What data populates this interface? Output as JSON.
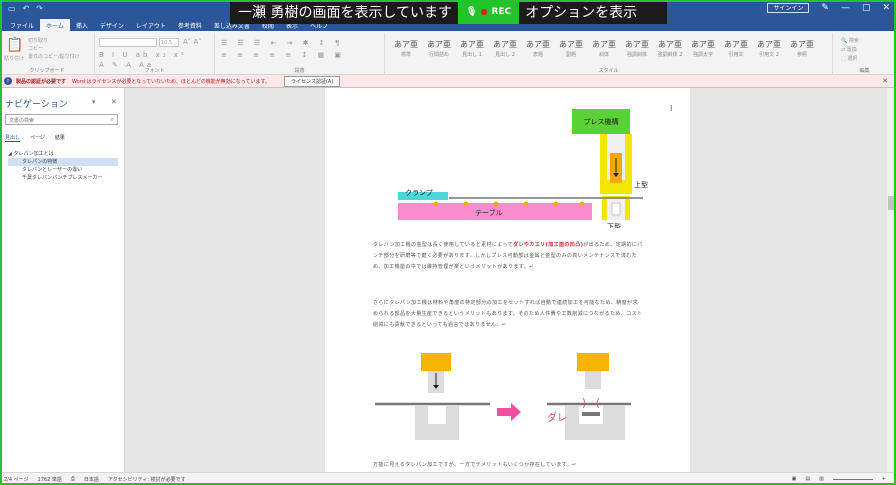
{
  "screen_share": {
    "presenter": "一瀬 勇樹の画面を表示しています",
    "rec_label": "REC",
    "options_label": "オプションを表示"
  },
  "title_bar": {
    "signin": "サインイン",
    "undo": "↶",
    "redo": "↷",
    "save": "▭"
  },
  "ribbon_tabs": [
    "ファイル",
    "ホーム",
    "挿入",
    "デザイン",
    "レイアウト",
    "参考資料",
    "差し込み文書",
    "校閲",
    "表示",
    "ヘルプ"
  ],
  "ribbon": {
    "clipboard": {
      "label": "クリップボード",
      "paste": "貼り付け",
      "cut": "切り取り",
      "copy": "コピー",
      "format_painter": "書式のコピー/貼り付け"
    },
    "font": {
      "label": "フォント",
      "font_size": "10.5"
    },
    "paragraph": {
      "label": "段落"
    },
    "styles": {
      "label": "スタイル",
      "items": [
        {
          "sample": "あア亜",
          "name": "標準"
        },
        {
          "sample": "あア亜",
          "name": "行間詰め"
        },
        {
          "sample": "あア亜",
          "name": "見出し 1"
        },
        {
          "sample": "あア亜",
          "name": "見出し 2"
        },
        {
          "sample": "あア亜",
          "name": "表題"
        },
        {
          "sample": "あア亜",
          "name": "副題"
        },
        {
          "sample": "あア亜",
          "name": "斜体"
        },
        {
          "sample": "あア亜",
          "name": "強調斜体"
        },
        {
          "sample": "あア亜",
          "name": "強調斜体 2"
        },
        {
          "sample": "あア亜",
          "name": "強調太字"
        },
        {
          "sample": "あア亜",
          "name": "引用文"
        },
        {
          "sample": "あア亜",
          "name": "引用文 2"
        },
        {
          "sample": "あア亜",
          "name": "参照"
        }
      ]
    },
    "editing": {
      "label": "編集",
      "find": "検索",
      "replace": "置換",
      "select": "選択"
    }
  },
  "banner": {
    "title": "製品の認証が必要です",
    "message": "Word はライセンスが必要となっていないため、ほとんどの機能が無効になっています。",
    "button": "ライセンス認証(A)"
  },
  "nav_pane": {
    "title": "ナビゲーション",
    "search_placeholder": "文書の検索",
    "tabs": [
      "見出し",
      "ページ",
      "結果"
    ],
    "tree": [
      "タレパン加工とは",
      "タレパンの特徴",
      "タレパンとレーザーの違い",
      "千葉タレパンパンチプレスメーカー"
    ]
  },
  "document": {
    "labels": {
      "press": "プレス機構",
      "clamp": "クランプ",
      "table": "テーブル",
      "upper": "上型",
      "lower": "下型",
      "dare": "ダレ"
    },
    "para1_before": "タレパン加工機の金型は長く使用していると素材によって",
    "para1_red": "ダレやカエリ(加工面の凹凸)",
    "para1_after": "が出るため、定期的にパンチ部分を研磨等で磨く必要があります。しかしプレス可動部は金属と金型のみの高いメンテナンスで済むため、加工機能の中では維持管理が楽というメリットがあります。↵",
    "para2": "さらにタレパン加工機は材料や角度の特定部分の加工をセットすれば自動で連続加工を可能なため、精度が求められる部品を大量生産できるというメリットもあります。そのため人件費や工数削減につながるため、コスト削減にも貢献できるといっても過言ではありません。↵",
    "para3": "万能に見えるタレパン加工ですが、一方でデメリットもいくつか存在しています。↵"
  },
  "status_bar": {
    "page": "2/4 ページ",
    "words": "1762 単語",
    "lang": "日本語",
    "accessibility": "アクセシビリティ: 検討が必要です",
    "zoom": "+"
  },
  "colors": {
    "word_blue": "#2b579a",
    "share_green": "#22c42a",
    "press_green": "#5cd136",
    "yellow": "#f3d100",
    "orange": "#f6a800",
    "pink": "#f98ccf",
    "cyan": "#4fd6d8",
    "arrow_pink": "#ef4f9f",
    "dare_red": "#e05050"
  }
}
